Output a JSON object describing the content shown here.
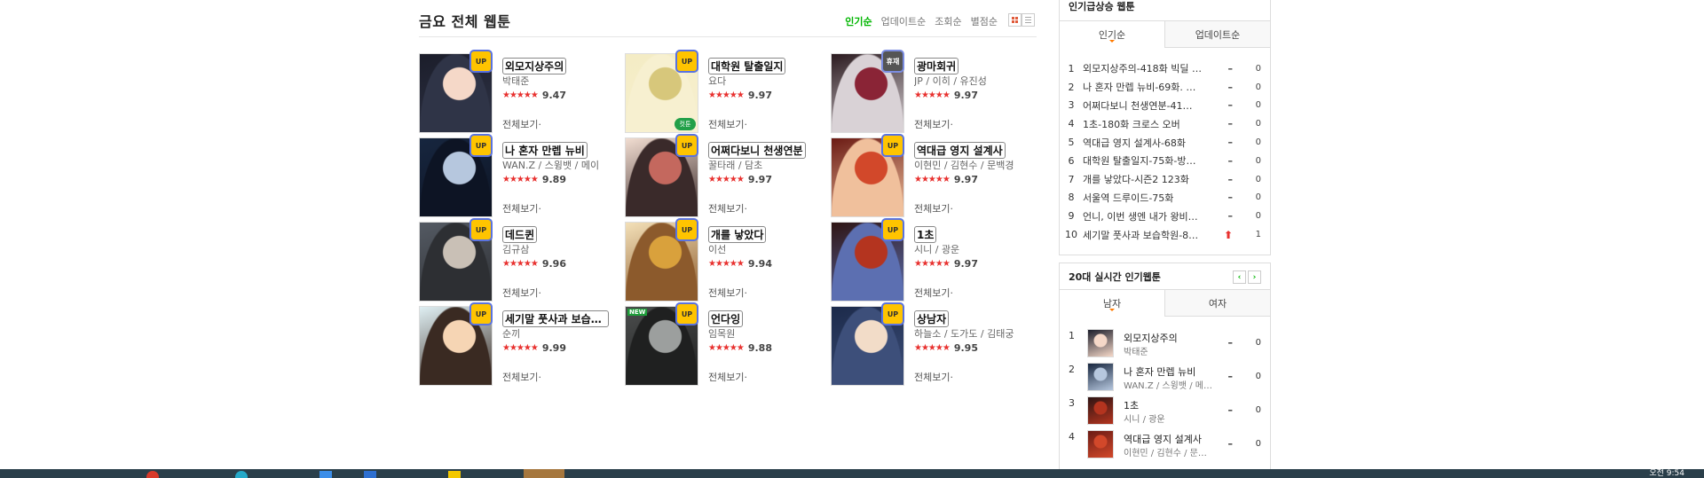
{
  "main": {
    "title": "금요 전체 웹툰",
    "sorts": [
      "인기순",
      "업데이트순",
      "조회순",
      "별점순"
    ],
    "active_sort": "인기순"
  },
  "webtoons": [
    {
      "title": "외모지상주의",
      "author": "박태준",
      "score": "9.47",
      "badge": "UP",
      "more": "전체보기·"
    },
    {
      "title": "대학원 탈출일지",
      "author": "요다",
      "score": "9.97",
      "badge": "UP",
      "cut": "컷툰",
      "more": "전체보기·"
    },
    {
      "title": "광마회귀",
      "author": "JP / 이히 / 유진성",
      "score": "9.97",
      "badge": "휴재",
      "more": "전체보기·"
    },
    {
      "title": "나 혼자 만렙 뉴비",
      "author": "WAN.Z / 스윙뱃 / 메이",
      "score": "9.89",
      "badge": "UP",
      "more": "전체보기·"
    },
    {
      "title": "어쩌다보니 천생연분",
      "author": "꿀타래 / 담초",
      "score": "9.97",
      "badge": "UP",
      "more": "전체보기·"
    },
    {
      "title": "역대급 영지 설계사",
      "author": "이현민 / 김현수 / 문백경",
      "score": "9.97",
      "badge": "UP",
      "more": "전체보기·"
    },
    {
      "title": "데드퀸",
      "author": "김규삼",
      "score": "9.96",
      "badge": "UP",
      "more": "전체보기·"
    },
    {
      "title": "개를 낳았다",
      "author": "이선",
      "score": "9.94",
      "badge": "UP",
      "more": "전체보기·"
    },
    {
      "title": "1초",
      "author": "시니 / 광운",
      "score": "9.97",
      "badge": "UP",
      "more": "전체보기·"
    },
    {
      "title": "세기말 풋사과 보습학원",
      "author": "순끼",
      "score": "9.99",
      "badge": "UP",
      "more": "전체보기·"
    },
    {
      "title": "언다잉",
      "author": "임목원",
      "score": "9.88",
      "badge": "UP",
      "new": "NEW",
      "more": "전체보기·"
    },
    {
      "title": "상남자",
      "author": "하늘소 / 도가도 / 김태궁",
      "score": "9.95",
      "badge": "UP",
      "more": "전체보기·"
    }
  ],
  "rising": {
    "title": "인기급상승 웹툰",
    "tabs": [
      "인기순",
      "업데이트순"
    ],
    "items": [
      {
        "rank": "1",
        "title": "외모지상주의-418화 빅딜 …",
        "change": "–",
        "value": "0"
      },
      {
        "rank": "2",
        "title": "나 혼자 만렙 뉴비-69화. …",
        "change": "–",
        "value": "0"
      },
      {
        "rank": "3",
        "title": "어쩌다보니 천생연분-41…",
        "change": "–",
        "value": "0"
      },
      {
        "rank": "4",
        "title": "1초-180화 크로스 오버",
        "change": "–",
        "value": "0"
      },
      {
        "rank": "5",
        "title": "역대급 영지 설계사-68화",
        "change": "–",
        "value": "0"
      },
      {
        "rank": "6",
        "title": "대학원 탈출일지-75화-방…",
        "change": "–",
        "value": "0"
      },
      {
        "rank": "7",
        "title": "개를 낳았다-시즌2 123화",
        "change": "–",
        "value": "0"
      },
      {
        "rank": "8",
        "title": "서울역 드루이드-75화",
        "change": "–",
        "value": "0"
      },
      {
        "rank": "9",
        "title": "언니, 이번 생엔 내가 왕비…",
        "change": "–",
        "value": "0"
      },
      {
        "rank": "10",
        "title": "세기말 풋사과 보습학원-8…",
        "change": "⬆",
        "value": "1"
      }
    ]
  },
  "realtime": {
    "title": "20대 실시간 인기웹툰",
    "tabs": [
      "남자",
      "여자"
    ],
    "prev": "‹",
    "next": "›",
    "items": [
      {
        "rank": "1",
        "title": "외모지상주의",
        "author": "박태준",
        "change": "–",
        "value": "0"
      },
      {
        "rank": "2",
        "title": "나 혼자 만렙 뉴비",
        "author": "WAN.Z / 스윙뱃 / 메…",
        "change": "–",
        "value": "0"
      },
      {
        "rank": "3",
        "title": "1초",
        "author": "시니 / 광운",
        "change": "–",
        "value": "0"
      },
      {
        "rank": "4",
        "title": "역대급 영지 설계사",
        "author": "이현민 / 김현수 / 문…",
        "change": "–",
        "value": "0"
      }
    ]
  },
  "taskbar": {
    "clock": "오전 9:54"
  },
  "colors": {
    "accent": "#00b600",
    "star": "#e8312f",
    "badge": "#ffc400"
  }
}
